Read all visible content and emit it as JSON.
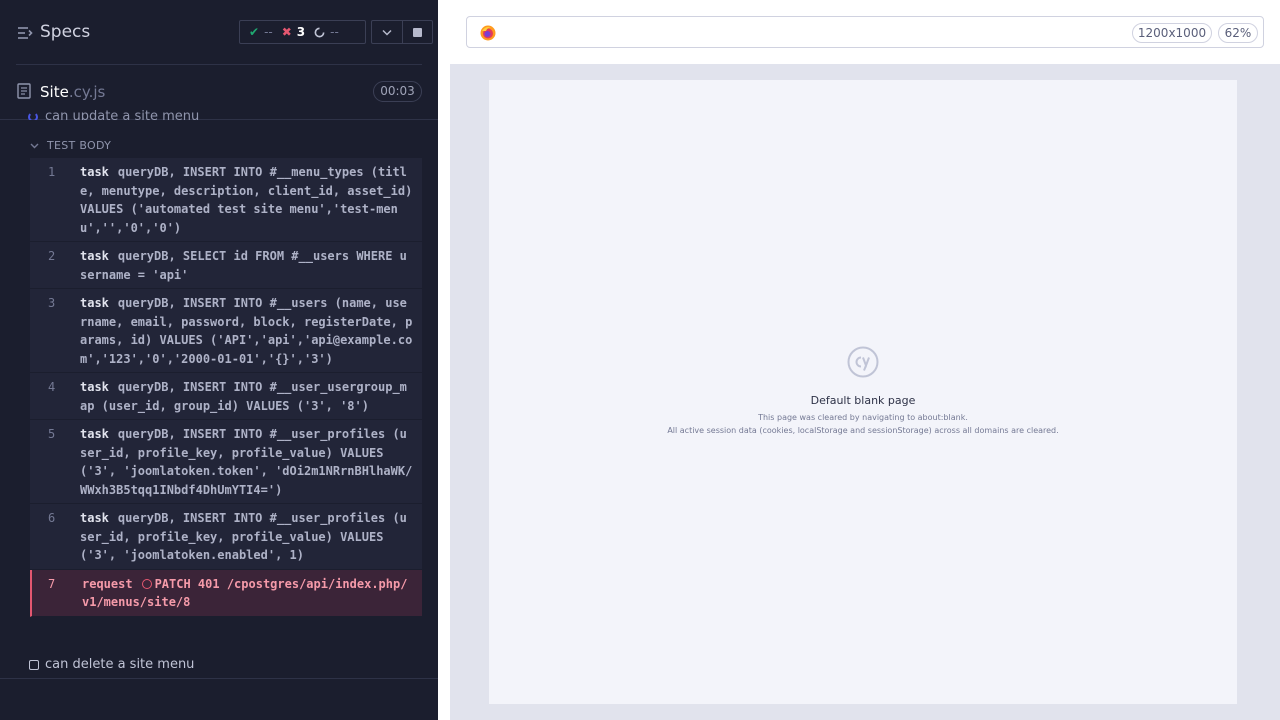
{
  "reporter": {
    "title": "Specs",
    "stats": {
      "passed_icon": "check-icon",
      "passed": "--",
      "failed_icon": "x-icon",
      "failed": "3",
      "pending_icon": "spinner-icon",
      "pending": "--"
    },
    "spec": {
      "base_name": "Site",
      "extension": ".cy.js",
      "duration": "00:03"
    },
    "previous_test": "can update a site menu",
    "section_label": "TEST BODY",
    "commands": [
      {
        "number": "1",
        "name": "task",
        "message": "queryDB, INSERT INTO #__menu_types (title, menutype, description, client_id, asset_id) VALUES ('automated test site menu','test-menu','','0','0')"
      },
      {
        "number": "2",
        "name": "task",
        "message": "queryDB, SELECT id FROM #__users WHERE username = 'api'"
      },
      {
        "number": "3",
        "name": "task",
        "message": "queryDB, INSERT INTO #__users (name, username, email, password, block, registerDate, params, id) VALUES ('API','api','api@example.com','123','0','2000-01-01','{}','3')"
      },
      {
        "number": "4",
        "name": "task",
        "message": "queryDB, INSERT INTO #__user_usergroup_map (user_id, group_id) VALUES ('3', '8')"
      },
      {
        "number": "5",
        "name": "task",
        "message": "queryDB, INSERT INTO #__user_profiles (user_id, profile_key, profile_value) VALUES ('3', 'joomlatoken.token', 'dOi2m1NRrnBHlhaWK/WWxh3B5tqq1INbdf4DhUmYTI4=')"
      },
      {
        "number": "6",
        "name": "task",
        "message": "queryDB, INSERT INTO #__user_profiles (user_id, profile_key, profile_value) VALUES ('3', 'joomlatoken.enabled', 1)"
      }
    ],
    "failed_command": {
      "number": "7",
      "name": "request",
      "message": "PATCH 401 /cpostgres/api/index.php/v1/menus/site/8"
    },
    "next_test": "can delete a site menu"
  },
  "preview": {
    "viewport": "1200x1000",
    "zoom": "62%",
    "blank_page": {
      "title": "Default blank page",
      "line1": "This page was cleared by navigating to about:blank.",
      "line2": "All active session data (cookies, localStorage and sessionStorage) across all domains are cleared."
    }
  },
  "colors": {
    "reporter_bg": "#1b1e2e",
    "command_bg": "#222538",
    "failed_bg": "#3b2438",
    "failed_accent": "#e45770",
    "passed_accent": "#1fa971",
    "preview_bg": "#e1e3ed"
  }
}
